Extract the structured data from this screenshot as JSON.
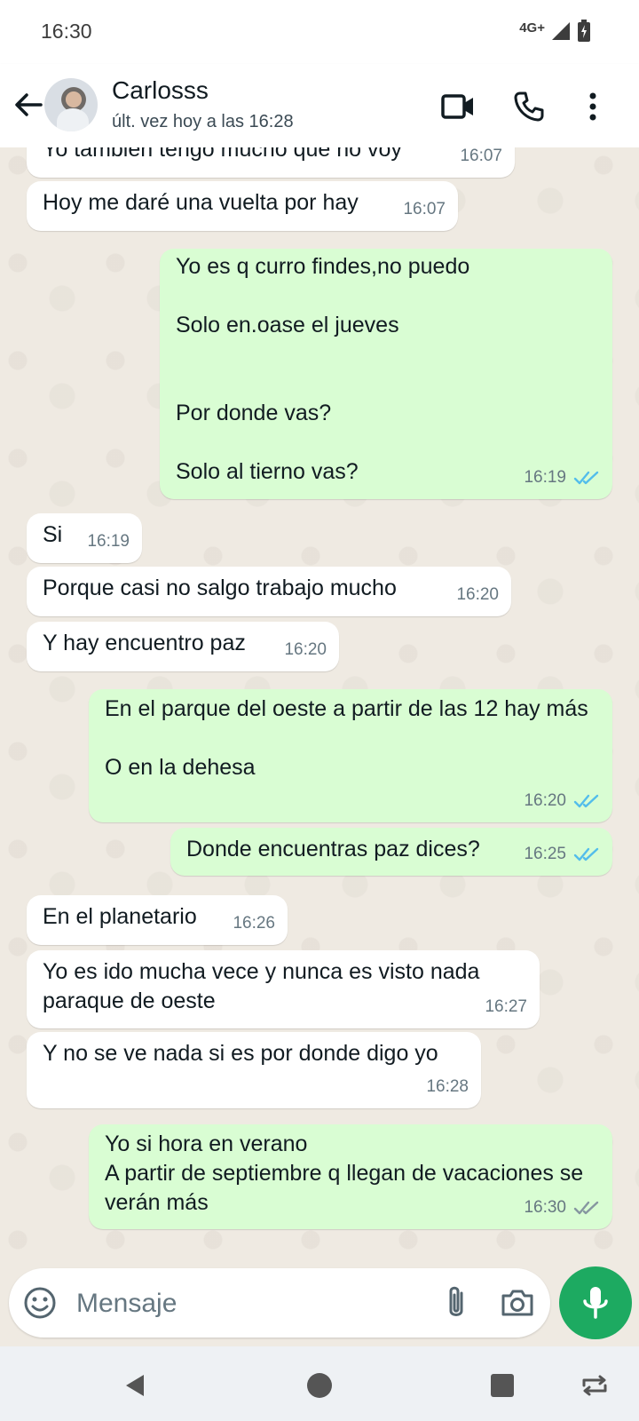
{
  "status_bar": {
    "time": "16:30",
    "network": "4G+"
  },
  "header": {
    "contact_name": "Carlosss",
    "last_seen": "últ. vez hoy a las 16:28"
  },
  "messages": [
    {
      "text": "Yo tambien tengo mucho que no voy",
      "time": "16:07"
    },
    {
      "text": "Hoy me daré una vuelta por hay",
      "time": "16:07"
    },
    {
      "text": "Yo es q curro findes,no puedo\n\nSolo en.oase el jueves\n\n\nPor donde vas?\n\nSolo al tierno vas?",
      "time": "16:19",
      "status": "read"
    },
    {
      "text": "Si",
      "time": "16:19"
    },
    {
      "text": "Porque casi no salgo trabajo mucho",
      "time": "16:20"
    },
    {
      "text": "Y hay encuentro paz",
      "time": "16:20"
    },
    {
      "text": "En el parque del oeste a partir de las 12 hay más\n\nO en la dehesa",
      "time": "16:20",
      "status": "read"
    },
    {
      "text": "Donde encuentras paz dices?",
      "time": "16:25",
      "status": "read"
    },
    {
      "text": "En el planetario",
      "time": "16:26"
    },
    {
      "text": "Yo es ido mucha vece y nunca es visto nada paraque de oeste",
      "time": "16:27"
    },
    {
      "text": "Y no se ve nada si es por donde digo yo",
      "time": "16:28"
    },
    {
      "text": "Yo si hora en verano\nA partir de septiembre q llegan de vacaciones se verán más",
      "time": "16:30",
      "status": "delivered"
    }
  ],
  "composer": {
    "placeholder": "Mensaje"
  },
  "colors": {
    "incoming_bubble": "#ffffff",
    "outgoing_bubble": "#d9fdd3",
    "read_ticks": "#53bdeb",
    "delivered_ticks": "#8696a0",
    "mic_button": "#1daa61"
  },
  "icons": {
    "header": [
      "back-arrow-icon",
      "video-call-icon",
      "phone-icon",
      "more-vert-icon"
    ],
    "composer": [
      "emoji-icon",
      "attach-icon",
      "camera-icon",
      "mic-icon"
    ],
    "nav": [
      "nav-back-icon",
      "nav-home-icon",
      "nav-recents-icon",
      "nav-rotate-icon"
    ]
  }
}
